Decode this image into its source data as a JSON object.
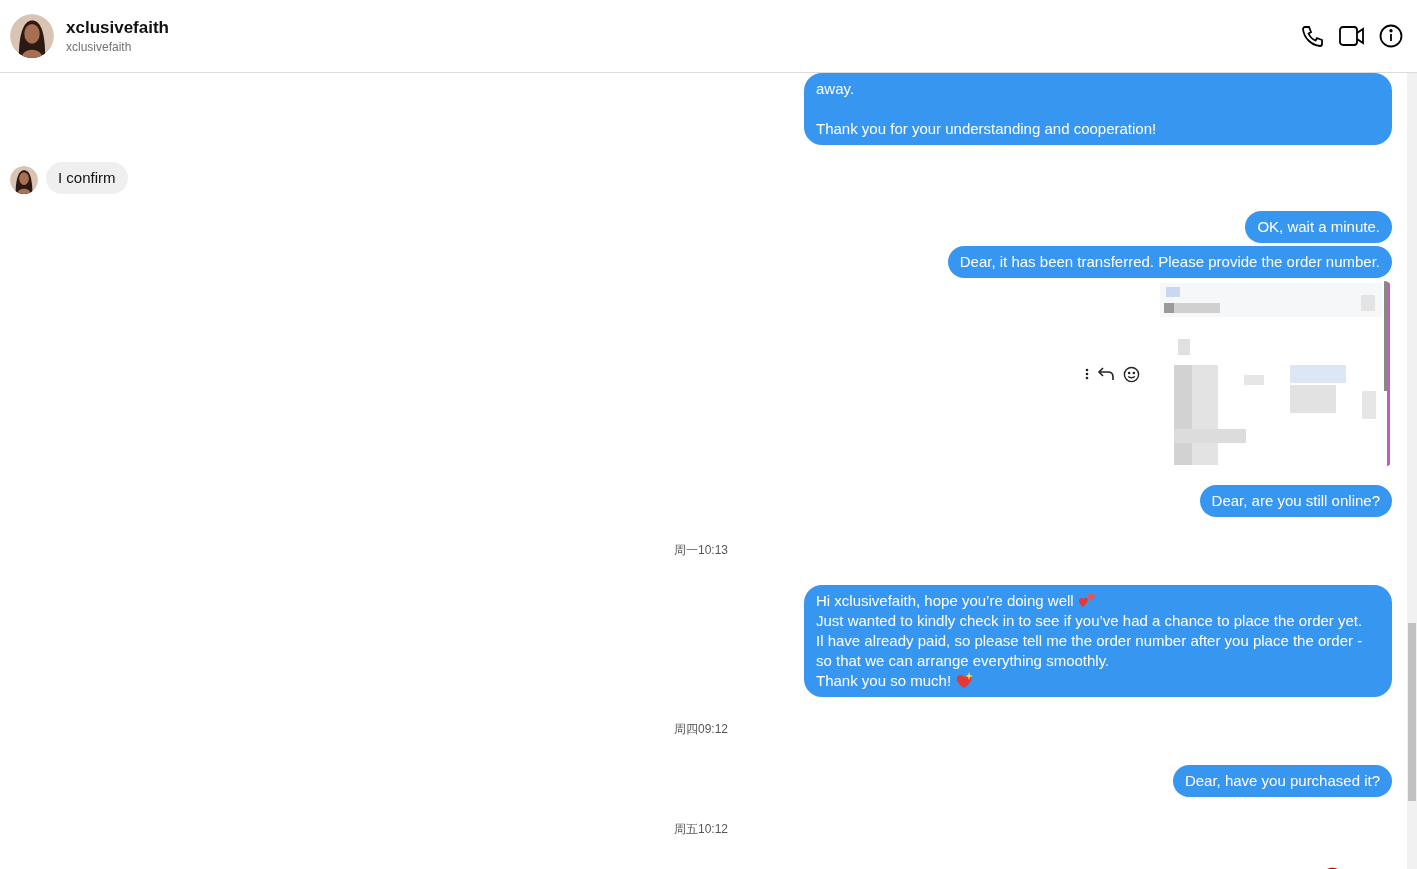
{
  "header": {
    "name": "xclusivefaith",
    "username": "xclusivefaith"
  },
  "messages": [
    {
      "kind": "sent-text",
      "paragraphs": [
        {
          "text": "away."
        },
        {
          "text": "Thank you for your understanding and cooperation!"
        }
      ]
    },
    {
      "kind": "received-text",
      "paragraphs": [
        {
          "text": "I confirm"
        }
      ]
    },
    {
      "kind": "sent-text",
      "paragraphs": [
        {
          "text": "OK, wait a minute."
        }
      ]
    },
    {
      "kind": "sent-text",
      "paragraphs": [
        {
          "text": "Dear, it has been transferred. Please provide the order number."
        }
      ]
    },
    {
      "kind": "sent-image"
    },
    {
      "kind": "sent-text",
      "paragraphs": [
        {
          "text": "Dear, are you still online?"
        }
      ]
    },
    {
      "kind": "timestamp",
      "text": "周一10:13"
    },
    {
      "kind": "sent-text",
      "lines": [
        {
          "text": "Hi xclusivefaith, hope you’re doing well",
          "kind": "hearts"
        },
        {
          "text": "Just wanted to kindly check in to see if you’ve had a chance to place the order yet.",
          "kind": "plain"
        },
        {
          "text": "Il have already paid, so please tell me the order number after you place the order -",
          "kind": "plain"
        },
        {
          "text": "so that we can arrange everything smoothly.",
          "kind": "plain"
        },
        {
          "text": "Thank you so much!",
          "kind": "sparkle"
        }
      ]
    },
    {
      "kind": "timestamp",
      "text": "周四09:12"
    },
    {
      "kind": "sent-text",
      "paragraphs": [
        {
          "text": "Dear, have you purchased it?"
        }
      ]
    },
    {
      "kind": "timestamp",
      "text": "周五10:12"
    },
    {
      "kind": "sent-partial-image"
    }
  ]
}
